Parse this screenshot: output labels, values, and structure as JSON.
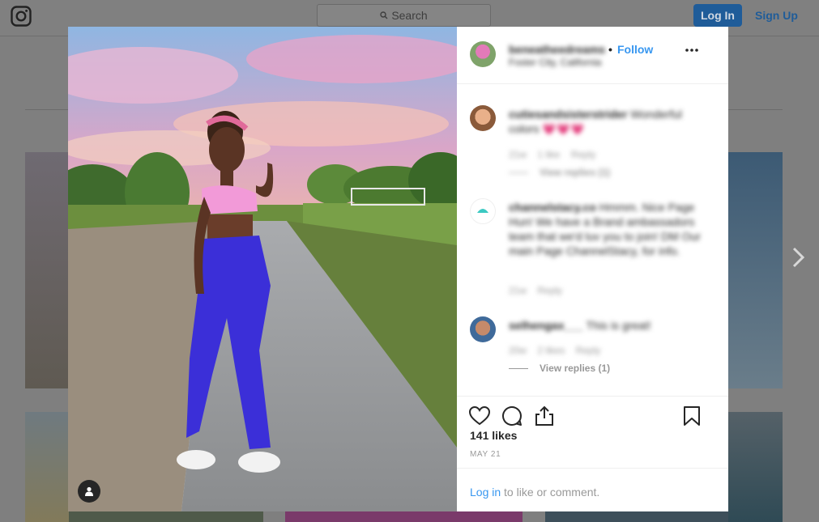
{
  "topbar": {
    "search_placeholder": "Search",
    "login_label": "Log In",
    "signup_label": "Sign Up"
  },
  "post": {
    "username": "beneatheedreams",
    "location": "Foster City, California",
    "follow_label": "Follow",
    "separator": "•",
    "comments": [
      {
        "user": "cutiesandsisterstrider",
        "text": "Wonderful colors 💗💗💗",
        "time": "21w",
        "likes": "1 like",
        "reply": "Reply",
        "view_replies": "View replies (1)"
      },
      {
        "user": "channelstacy.co",
        "text": "Hmmm. Nice Page Hun! We have a Brand ambassadors team that we'd luv you to join! DM Our main Page ChannelStacy, for info.",
        "time": "21w",
        "reply": "Reply"
      },
      {
        "user": "selhengax___",
        "text": "This is great!",
        "time": "20w",
        "likes": "2 likes",
        "reply": "Reply",
        "view_replies": "View replies (1)"
      }
    ],
    "likes": "141 likes",
    "date": "MAY 21",
    "login_link": "Log in",
    "login_suffix": " to like or comment."
  },
  "colors": {
    "accent": "#3897f0",
    "text": "#262626",
    "muted": "#999999",
    "pants": "#3b2fd8",
    "top": "#f29ad8"
  },
  "icons": [
    "instagram-logo-icon",
    "search-icon",
    "chevron-right-icon",
    "more-icon",
    "heart-icon",
    "comment-icon",
    "share-icon",
    "bookmark-icon",
    "user-tag-icon"
  ]
}
